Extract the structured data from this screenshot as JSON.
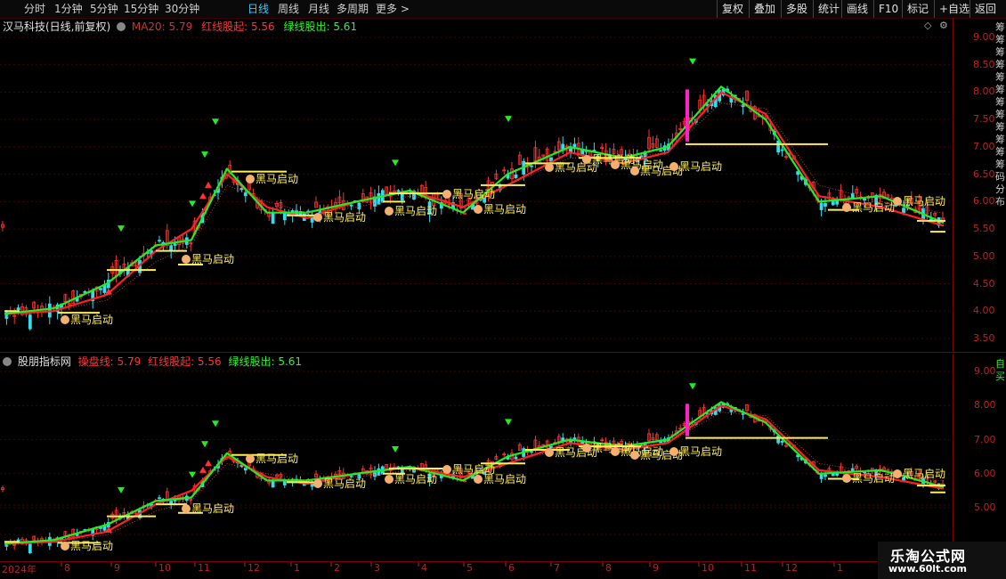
{
  "toolbar": {
    "periods": [
      "分时",
      "1分钟",
      "5分钟",
      "15分钟",
      "30分钟",
      "日线",
      "周线",
      "月线",
      "多周期",
      "更多 >"
    ],
    "active_period": "日线",
    "right_buttons": [
      "复权",
      "叠加",
      "多股",
      "统计",
      "画线",
      "F10",
      "标记",
      "+自选",
      "返回"
    ]
  },
  "main_panel": {
    "stock_title": "汉马科技(日线,前复权)",
    "ma_label": "MA20: 5.79",
    "red_label": "红线股起: 5.56",
    "green_label": "绿线股出: 5.61",
    "y_ticks": [
      "9.00",
      "8.50",
      "8.00",
      "7.50",
      "7.00",
      "6.50",
      "6.00",
      "5.50",
      "5.00",
      "4.50",
      "4.00",
      "3.50"
    ],
    "right_vertical_text": "筹筹筹筹筹筹筹筹筹筹筹筹码分布"
  },
  "sub_panel": {
    "indicator_title": "股朋指标网",
    "operate_label": "操盘线: 5.79",
    "red_label": "红线股起: 5.56",
    "green_label": "绿线股出: 5.61",
    "y_ticks": [
      "9.00",
      "8.00",
      "7.00",
      "6.00",
      "5.00"
    ],
    "right_vertical_text": "自买"
  },
  "x_axis": {
    "labels": [
      "2024年",
      "8",
      "9",
      "10",
      "11",
      "12",
      "1",
      "2",
      "3",
      "4",
      "5",
      "6",
      "7",
      "8",
      "9",
      "10",
      "11",
      "12",
      "1"
    ]
  },
  "signal_label": "黑马启动",
  "watermark": {
    "title": "乐淘公式网",
    "url": "www.60lt.com"
  },
  "colors": {
    "up": "#ff3333",
    "down": "#33ddee",
    "red_line": "#ff2222",
    "green_line": "#22ee22",
    "ma20": "#cc3333",
    "signal": "#ffee55",
    "axis": "#bb2222"
  },
  "chart_data": {
    "type": "line",
    "title": "汉马科技(日线,前复权)",
    "ylim": [
      3.25,
      9.2
    ],
    "x": [
      "2024年",
      "8",
      "9",
      "10",
      "11",
      "12",
      "1",
      "2",
      "3",
      "4",
      "5",
      "6",
      "7",
      "8",
      "9",
      "10",
      "11",
      "12",
      "1"
    ],
    "series": [
      {
        "name": "红线股起",
        "values": [
          3.95,
          4.0,
          4.3,
          5.1,
          5.5,
          6.5,
          5.9,
          5.7,
          6.0,
          6.2,
          5.9,
          6.3,
          6.9,
          6.7,
          6.9,
          8.0,
          7.6,
          6.1,
          5.9,
          5.56
        ]
      },
      {
        "name": "绿线股出",
        "values": [
          3.95,
          4.05,
          4.5,
          5.2,
          5.3,
          6.6,
          5.8,
          5.8,
          6.0,
          6.2,
          5.8,
          6.5,
          7.0,
          6.8,
          7.0,
          8.1,
          7.5,
          6.0,
          6.1,
          5.61
        ]
      },
      {
        "name": "MA20",
        "values": [
          3.9,
          4.0,
          4.2,
          4.9,
          5.2,
          6.3,
          6.0,
          5.8,
          5.9,
          6.1,
          6.0,
          6.3,
          6.8,
          6.8,
          6.9,
          7.8,
          7.7,
          6.3,
          6.0,
          5.79
        ]
      }
    ]
  }
}
